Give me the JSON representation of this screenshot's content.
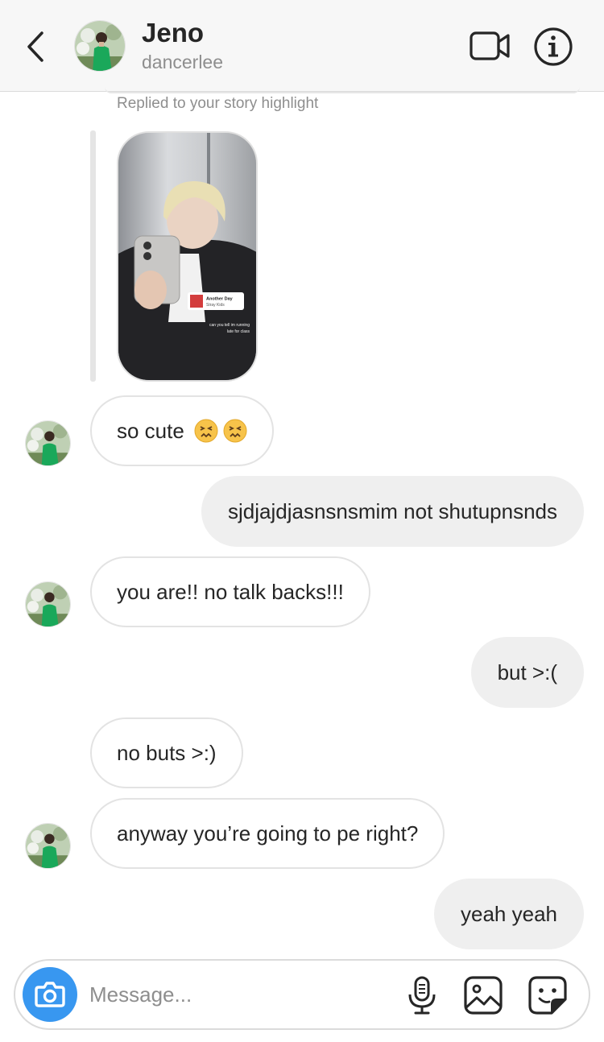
{
  "header": {
    "name": "Jeno",
    "username": "dancerlee"
  },
  "thread": {
    "reply_caption": "Replied to your story highlight",
    "story_sticker": {
      "title": "Another Day",
      "artist": "Stray Kids"
    },
    "story_caption_line1": "can you tell im running",
    "story_caption_line2": "late for class",
    "messages": [
      {
        "from": "them",
        "text": "so cute",
        "emoji": [
          "confounded-face-icon",
          "confounded-face-icon"
        ]
      },
      {
        "from": "me",
        "text": "sjdjajdjasnsnsmim not shutupnsnds"
      },
      {
        "from": "them",
        "text": "you are!! no talk backs!!!"
      },
      {
        "from": "me",
        "text": "but >:("
      },
      {
        "from": "them",
        "text": "no buts >:)"
      },
      {
        "from": "them",
        "text": "anyway you’re going to pe right?"
      },
      {
        "from": "me",
        "text": "yeah yeah"
      }
    ]
  },
  "composer": {
    "placeholder": "Message..."
  },
  "colors": {
    "header_bg": "#f7f7f7",
    "camera_button": "#3897f0",
    "incoming_border": "#e3e3e3",
    "outgoing_bg": "#efefef",
    "secondary_text": "#8e8e8e"
  }
}
